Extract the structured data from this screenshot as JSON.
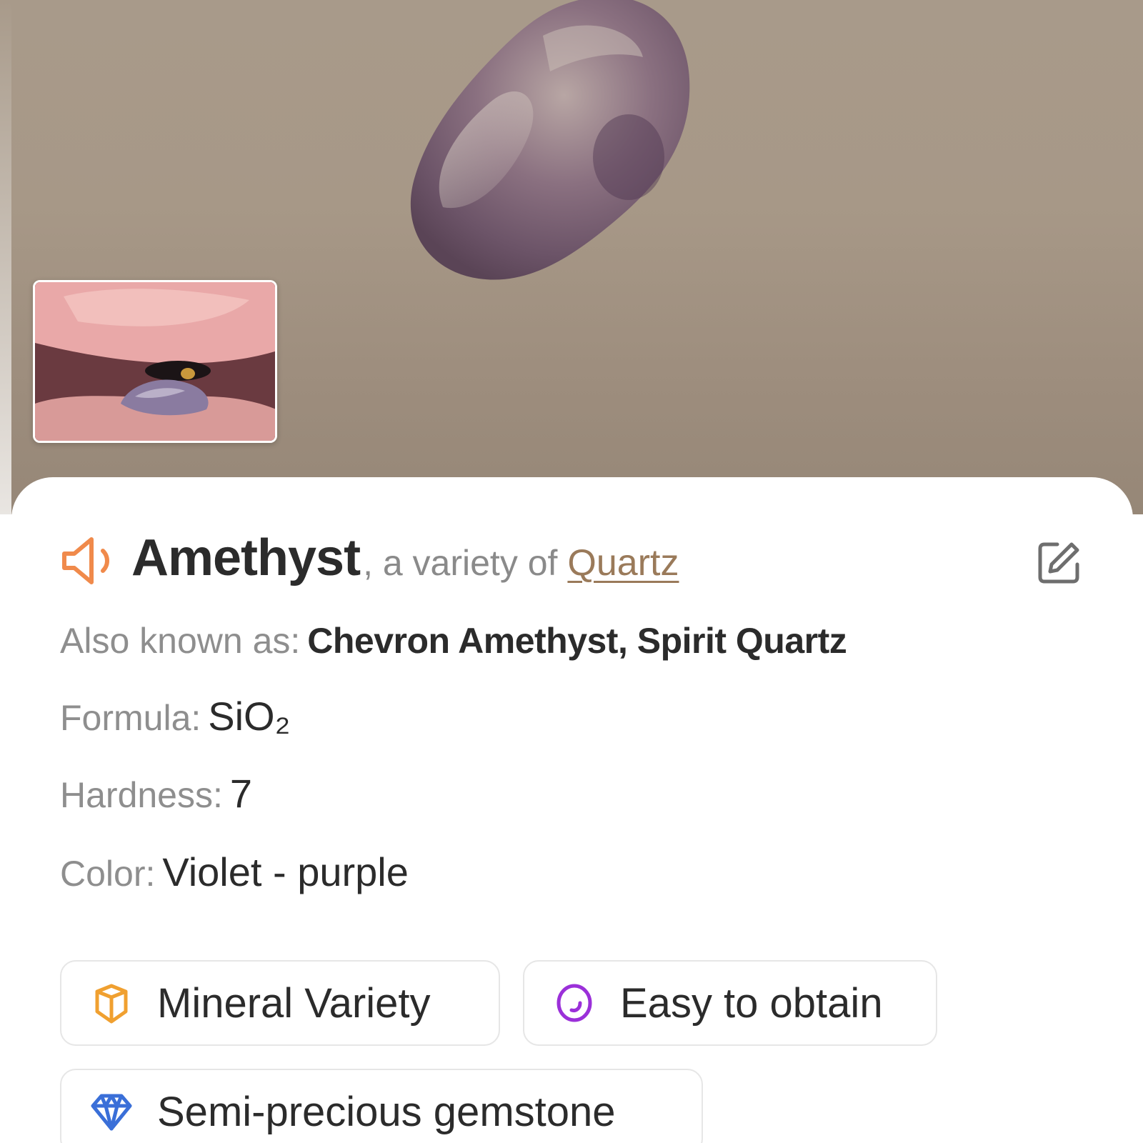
{
  "hero": {
    "icons": {
      "photo": "amethyst-photo",
      "thumbnail": "finger-holding-stone-thumbnail"
    }
  },
  "header": {
    "name": "Amethyst",
    "subtitle": ", a variety of",
    "parent_link": "Quartz",
    "icons": {
      "speaker": "speaker-icon",
      "edit": "edit-icon"
    },
    "accent_color": "#f08a4b",
    "link_color": "#9a7a5a"
  },
  "properties": {
    "aka_label": "Also known as:",
    "aka_value": "Chevron Amethyst, Spirit Quartz",
    "formula_label": "Formula:",
    "formula_value": "SiO₂",
    "hardness_label": "Hardness:",
    "hardness_value": "7",
    "color_label": "Color:",
    "color_value": "Violet - purple"
  },
  "tags": [
    {
      "label": "Mineral Variety",
      "icon": "crystal-icon",
      "color": "#f0a030"
    },
    {
      "label": "Easy to obtain",
      "icon": "ring-icon",
      "color": "#9b30d9"
    },
    {
      "label": "Semi-precious gemstone",
      "icon": "diamond-icon",
      "color": "#3a6fd8"
    }
  ]
}
